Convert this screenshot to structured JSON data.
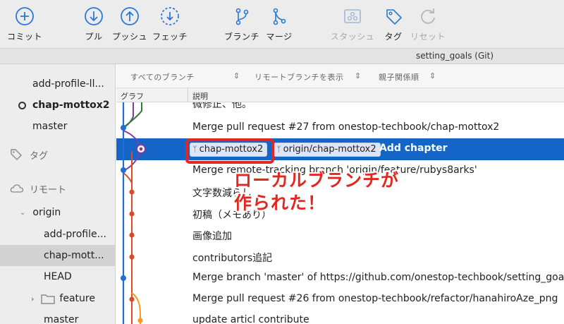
{
  "toolbar": {
    "commit": "コミット",
    "pull": "プル",
    "push": "プッシュ",
    "fetch": "フェッチ",
    "branch": "ブランチ",
    "merge": "マージ",
    "stash": "スタッシュ",
    "tag": "タグ",
    "reset": "リセット"
  },
  "window": {
    "title": "setting_goals (Git)"
  },
  "sidebar": {
    "items": [
      {
        "label": "add-profile-ll..."
      },
      {
        "label": "chap-mottox2"
      },
      {
        "label": "master"
      },
      {
        "label": "タグ"
      },
      {
        "label": "リモート"
      },
      {
        "label": "origin"
      },
      {
        "label": "add-profile..."
      },
      {
        "label": "chap-mott..."
      },
      {
        "label": "HEAD"
      },
      {
        "label": "feature"
      },
      {
        "label": "master"
      }
    ]
  },
  "filters": {
    "branches": "すべてのブランチ",
    "remote": "リモートブランチを表示",
    "order": "親子関係順"
  },
  "columns": {
    "graph": "グラフ",
    "description": "説明"
  },
  "commits": [
    {
      "message": "微修正、他。"
    },
    {
      "message": "Merge pull request #27 from onestop-techbook/chap-mottox2"
    },
    {
      "message": "Add chapter",
      "local_branch": "chap-mottox2",
      "remote_branch": "origin/chap-mottox2"
    },
    {
      "message": "Merge remote-tracking branch 'origin/feature/rubys8arks'"
    },
    {
      "message": "文字数減らし"
    },
    {
      "message": "初稿（メモあり）"
    },
    {
      "message": "画像追加"
    },
    {
      "message": "contributors追記"
    },
    {
      "message": "Merge branch 'master' of https://github.com/onestop-techbook/setting_goals"
    },
    {
      "message": "Merge pull request #26 from onestop-techbook/refactor/hanahiroAze_png"
    },
    {
      "message": "update articl contribute"
    }
  ],
  "annotation": {
    "line1": "ローカルブランチが",
    "line2": "作られた！"
  },
  "colors": {
    "accent": "#1565c9",
    "annotation": "#e3271f",
    "graph_blue": "#1e6fd1",
    "graph_green": "#2e7d32",
    "graph_red": "#d84a2a",
    "graph_purple": "#7b3fa0",
    "graph_orange": "#f39a21"
  }
}
